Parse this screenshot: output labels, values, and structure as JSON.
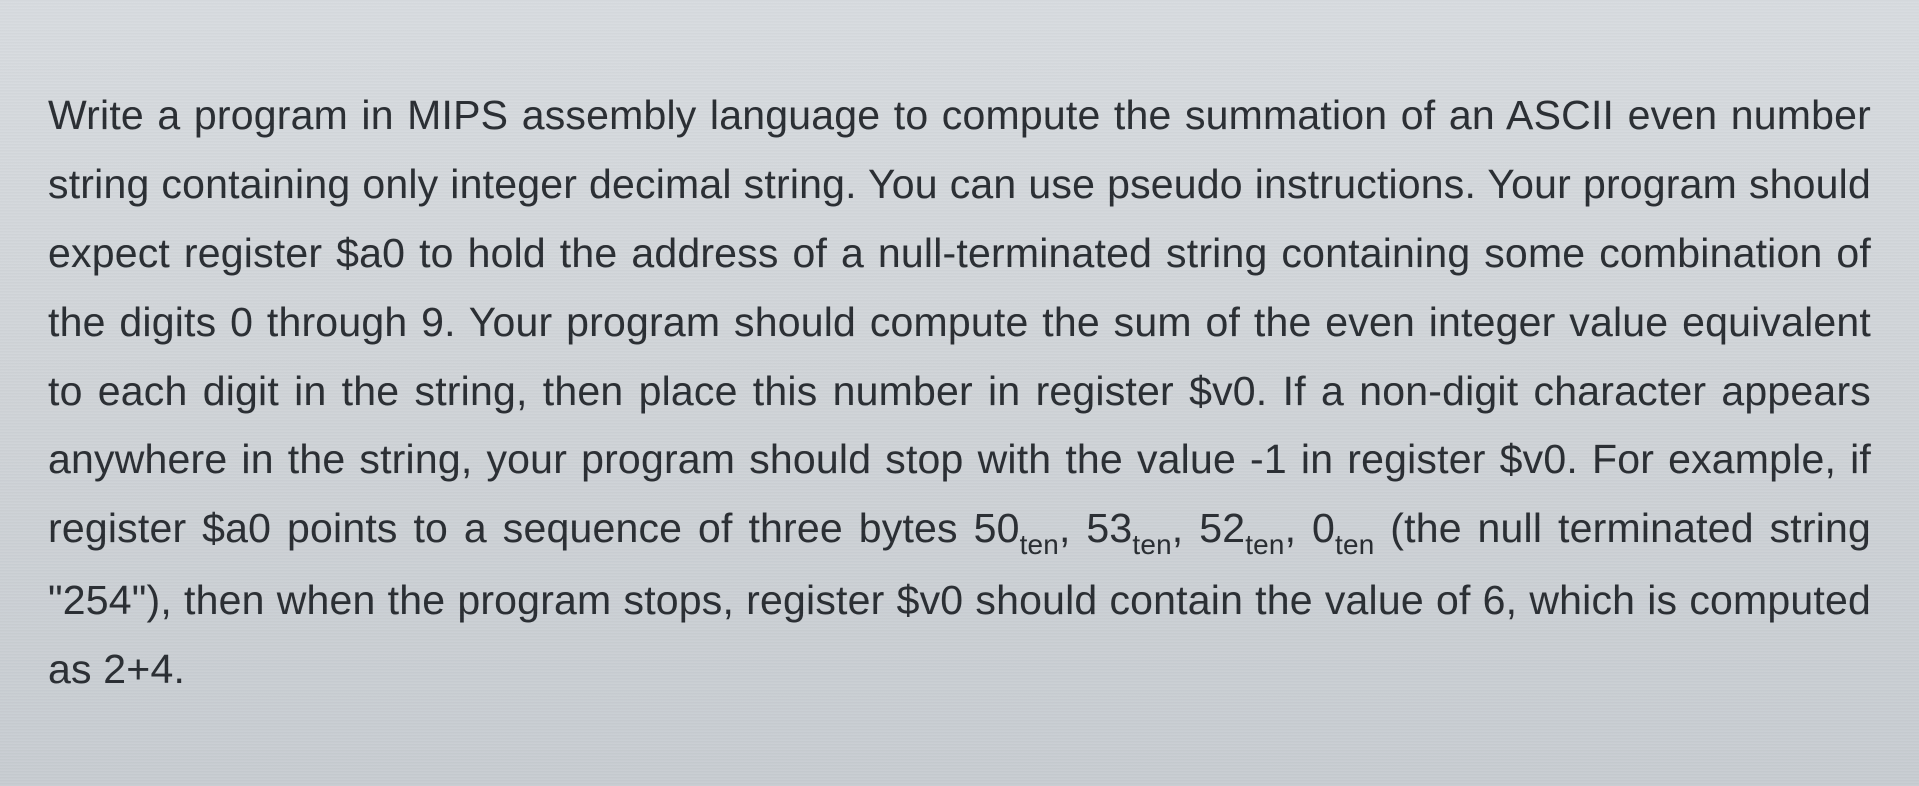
{
  "problem": {
    "para1_a": "Write a program in MIPS assembly language to compute the summation of an ASCII even number string containing only integer decimal string. You can use pseudo instructions. Your program should expect register $a0 to hold the address of a null-terminated string containing some combination of the digits 0 through 9. Your program should compute the sum of the even integer value equivalent to each digit in the string, then place this number in register $v0. If a non-digit character appears anywhere in the string, your program should stop with the value -1 in register $v0. For example, if register $a0 points to a sequence of three bytes 50",
    "sub1": "ten",
    "sep1": ", 53",
    "sub2": "ten",
    "sep2": ", 52",
    "sub3": "ten",
    "sep3": ", 0",
    "sub4": "ten",
    "para1_b": " (the null terminated string \"254\"), then when the program stops, register $v0 should contain the value of 6, which is computed as 2+4."
  }
}
